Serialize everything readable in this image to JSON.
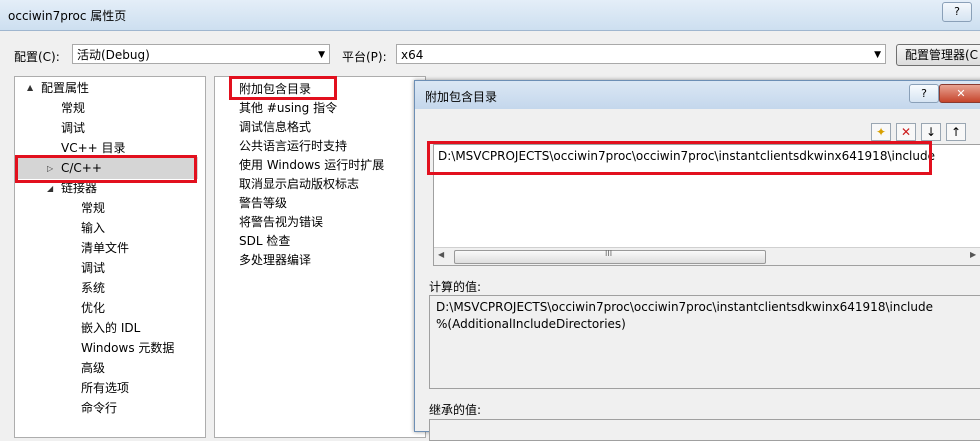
{
  "window": {
    "title": "occiwin7proc 属性页",
    "help": "?"
  },
  "config": {
    "config_label": "配置(C):",
    "config_value": "活动(Debug)",
    "platform_label": "平台(P):",
    "platform_value": "x64",
    "manager_button": "配置管理器(C"
  },
  "tree": {
    "items": [
      {
        "label": "配置属性",
        "expander": "▲"
      },
      {
        "label": "常规"
      },
      {
        "label": "调试"
      },
      {
        "label": "VC++ 目录"
      },
      {
        "label": "C/C++",
        "expander": "▷"
      },
      {
        "label": "链接器",
        "expander": "◢"
      },
      {
        "label": "常规"
      },
      {
        "label": "输入"
      },
      {
        "label": "清单文件"
      },
      {
        "label": "调试"
      },
      {
        "label": "系统"
      },
      {
        "label": "优化"
      },
      {
        "label": "嵌入的 IDL"
      },
      {
        "label": "Windows 元数据"
      },
      {
        "label": "高级"
      },
      {
        "label": "所有选项"
      },
      {
        "label": "命令行"
      }
    ]
  },
  "props": {
    "rows": [
      "附加包含目录",
      "其他 #using 指令",
      "调试信息格式",
      "公共语言运行时支持",
      "使用 Windows 运行时扩展",
      "取消显示启动版权标志",
      "警告等级",
      "将警告视为错误",
      "SDL 检查",
      "多处理器编译"
    ]
  },
  "dialog": {
    "title": "附加包含目录",
    "help": "?",
    "close": "✕",
    "path": "D:\\MSVCPROJECTS\\occiwin7proc\\occiwin7proc\\instantclientsdkwinx641918\\include",
    "scroll_thumb": "III",
    "computed_label": "计算的值:",
    "computed_line1": "D:\\MSVCPROJECTS\\occiwin7proc\\occiwin7proc\\instantclientsdkwinx641918\\include",
    "computed_line2": "%(AdditionalIncludeDirectories)",
    "inherited_label": "继承的值:"
  },
  "colors": {
    "highlight": "#e2101e"
  }
}
